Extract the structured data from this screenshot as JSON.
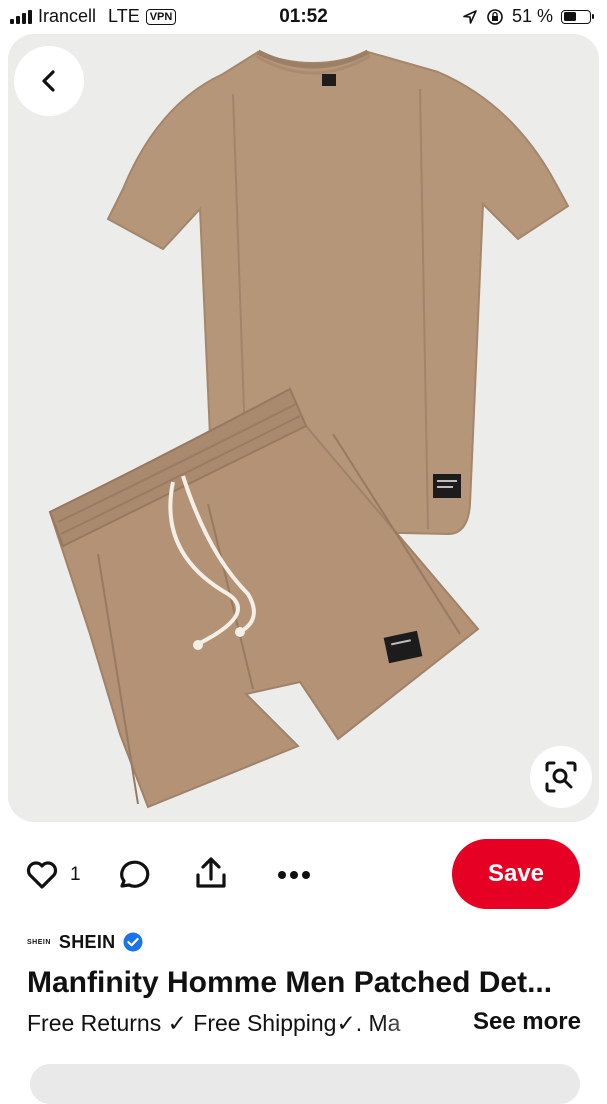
{
  "status_bar": {
    "carrier": "Irancell",
    "network": "LTE",
    "vpn": "VPN",
    "time": "01:52",
    "battery": "51 %",
    "battery_level": 0.51
  },
  "image": {
    "back_icon": "chevron-left-icon",
    "lens_icon": "visual-search-icon",
    "colors": {
      "background": "#ececea",
      "garment": "#b59578",
      "garment_shadow": "#9e7f64",
      "drawstring": "#f3efe6"
    }
  },
  "actions": {
    "like_icon": "heart-icon",
    "like_count": "1",
    "comment_icon": "comment-icon",
    "share_icon": "share-icon",
    "more_icon": "more-icon",
    "save_label": "Save",
    "save_color": "#e60023"
  },
  "source": {
    "logo_text": "SHEIN",
    "name": "SHEIN",
    "verified_color": "#1a73e8"
  },
  "pin": {
    "title": "Manfinity Homme Men Patched Det...",
    "description": "Free Returns ✓ Free Shipping✓. Ma",
    "see_more": "See more"
  }
}
